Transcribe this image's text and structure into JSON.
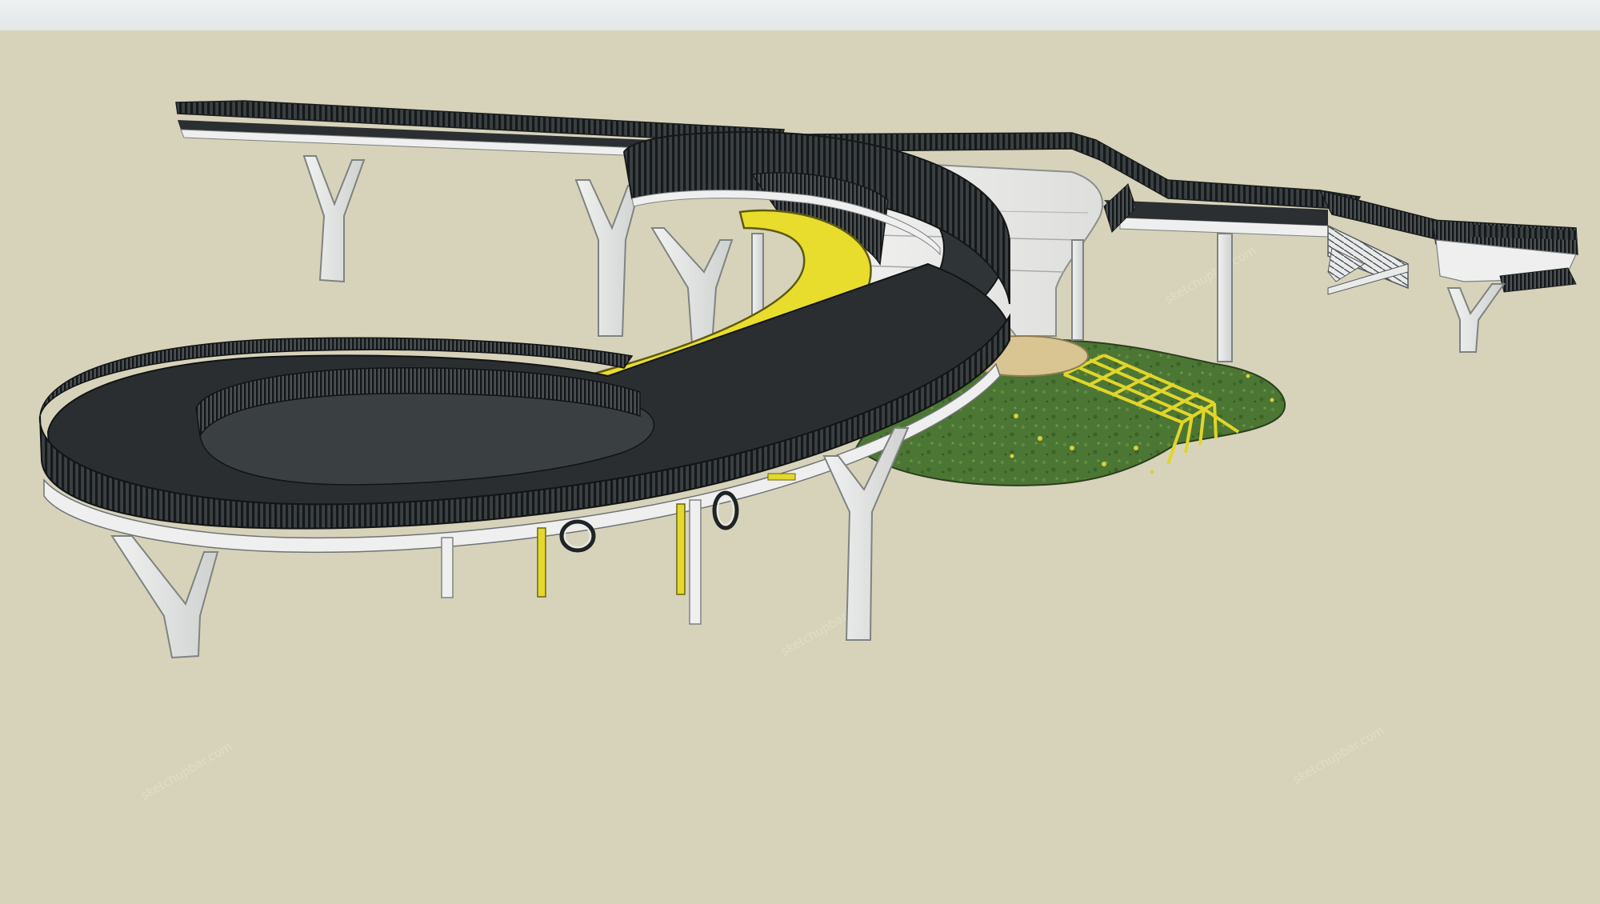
{
  "colors": {
    "background": "#d7d3ba",
    "top_strip": "#e8ecee",
    "deck_dark": "#2b2f31",
    "railing": "#1c1f20",
    "concrete": "#e4e5e4",
    "slide_yellow": "#e6dc2c",
    "lawn": "#4f7a37"
  },
  "watermark": {
    "text": "sketchupbar.com"
  }
}
